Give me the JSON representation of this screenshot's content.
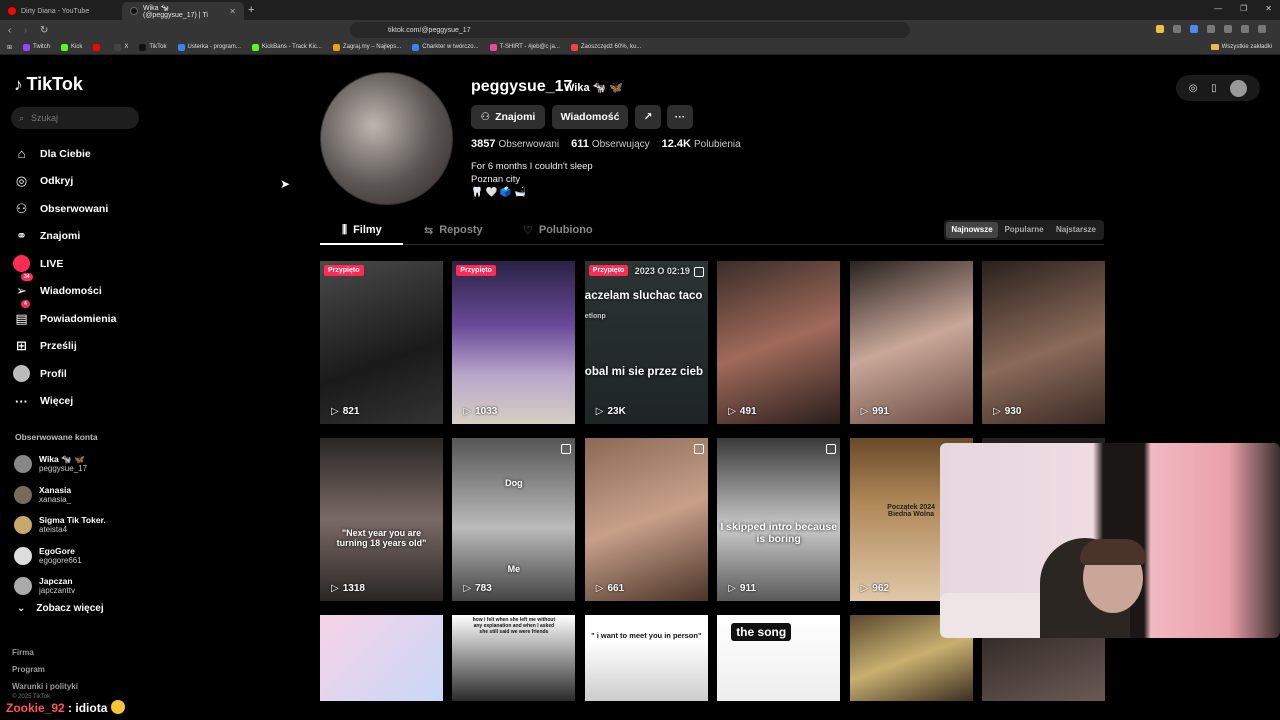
{
  "browser": {
    "tabs": [
      {
        "title": "Dirty Diana - YouTube",
        "active": false,
        "color": "#ff0000"
      },
      {
        "title": "Wika 🐄 (@peggysue_17) | Ti",
        "active": true,
        "color": "#111111"
      }
    ],
    "new_tab": "+",
    "url": "tiktok.com/@peggysue_17",
    "bookmarks": [
      {
        "label": "Twitch",
        "color": "#9146ff"
      },
      {
        "label": "Kick",
        "color": "#53fc18"
      },
      {
        "label": "",
        "color": "#ff0000"
      },
      {
        "label": "X",
        "color": "#444444"
      },
      {
        "label": "TikTok",
        "color": "#111111"
      },
      {
        "label": "Usterka - program...",
        "color": "#3b82f6"
      },
      {
        "label": "KickBans - Track Kic...",
        "color": "#53fc18"
      },
      {
        "label": "Zagraj.my – Najleps...",
        "color": "#f59e0b"
      },
      {
        "label": "Charkter w twórczo...",
        "color": "#3b82f6"
      },
      {
        "label": "T-SHIRT - #jeb@c ja...",
        "color": "#ec4899"
      },
      {
        "label": "Zaoszczędź 60%, ku...",
        "color": "#ef4444"
      }
    ],
    "bookmarks_right": "Wszystkie zakładki"
  },
  "sidebar": {
    "logo": "TikTok",
    "search_placeholder": "Szukaj",
    "nav": [
      {
        "label": "Dla Ciebie",
        "icon": "home-icon",
        "glyph": "⌂"
      },
      {
        "label": "Odkryj",
        "icon": "compass-icon",
        "glyph": "◎"
      },
      {
        "label": "Obserwowani",
        "icon": "following-icon",
        "glyph": "⚇"
      },
      {
        "label": "Znajomi",
        "icon": "friends-icon",
        "glyph": "⚭"
      },
      {
        "label": "LIVE",
        "icon": "live-icon",
        "glyph": ""
      },
      {
        "label": "Wiadomości",
        "icon": "messages-icon",
        "glyph": "➢",
        "badge": "34"
      },
      {
        "label": "Powiadomienia",
        "icon": "notifications-icon",
        "glyph": "▤",
        "badge": "4"
      },
      {
        "label": "Prześlij",
        "icon": "upload-icon",
        "glyph": "⊞"
      },
      {
        "label": "Profil",
        "icon": "profile-icon",
        "glyph": ""
      },
      {
        "label": "Więcej",
        "icon": "more-icon",
        "glyph": "···"
      }
    ],
    "following_title": "Obserwowane konta",
    "following": [
      {
        "name": "Wika 🐄 🦋",
        "user": "peggysue_17",
        "color": "#888888"
      },
      {
        "name": "Xanasia",
        "user": "xanasia_",
        "color": "#7a6a5a"
      },
      {
        "name": "Sigma Tik Toker.",
        "user": "ateista4",
        "color": "#c9a86a"
      },
      {
        "name": "EgoGore",
        "user": "egogore661",
        "color": "#dddddd"
      },
      {
        "name": "Japczan",
        "user": "japczanttv",
        "color": "#aaaaaa"
      }
    ],
    "see_more": "Zobacz więcej",
    "footer": [
      "Firma",
      "Program",
      "Warunki i polityki"
    ],
    "copyright": "© 2025 TikTok"
  },
  "profile": {
    "username": "peggysue_17",
    "nickname": "Wika 🐄 🦋",
    "buttons": {
      "friends": "Znajomi",
      "message": "Wiadomość"
    },
    "stats": [
      {
        "value": "3857",
        "label": "Obserwowani"
      },
      {
        "value": "611",
        "label": "Obserwujący"
      },
      {
        "value": "12.4K",
        "label": "Polubienia"
      }
    ],
    "bio": [
      "For 6 months I couldn't sleep",
      "Poznan city",
      "🦷 🤍 🗳️ 🛁"
    ]
  },
  "tabs": [
    {
      "label": "Filmy",
      "glyph": "⫼"
    },
    {
      "label": "Reposty",
      "glyph": "⇆"
    },
    {
      "label": "Polubiono",
      "glyph": "♡"
    }
  ],
  "sort": [
    "Najnowsze",
    "Popularne",
    "Najstarsze"
  ],
  "videos": [
    {
      "views": "821",
      "pinned": "Przypięto",
      "bg": "linear-gradient(160deg,#4a4a4a,#1a1a1a 60%,#333)"
    },
    {
      "views": "1033",
      "pinned": "Przypięto",
      "bg": "linear-gradient(180deg,#2b2244,#6a4a9a 40%,#b7a6c9 70%,#d8cfc4)"
    },
    {
      "views": "23K",
      "pinned": "Przypięto",
      "bg": "linear-gradient(180deg,#2c3433,#1e2524)",
      "caption_top": "aczelam sluchac taco",
      "caption_mid": "obal mi sie przez cieb",
      "date": "2023 O 02:19",
      "small": "etlonp"
    },
    {
      "views": "491",
      "bg": "linear-gradient(160deg,#3a2c28,#a06a5a 50%,#2a1e1c)"
    },
    {
      "views": "991",
      "bg": "linear-gradient(160deg,#2a2220,#c9a89a 50%,#6a4a40)"
    },
    {
      "views": "930",
      "bg": "linear-gradient(160deg,#2a201c,#8a6a5a 55%,#3a2a24)"
    },
    {
      "views": "1318",
      "bg": "linear-gradient(180deg,#2a2624,#7a6a66 50%,#2a2624)",
      "caption": "\"Next year you are turning 18 years old\""
    },
    {
      "views": "783",
      "bg": "linear-gradient(180deg,#555,#bbb 55%,#444)",
      "label_top": "Dog",
      "label_bottom": "Me"
    },
    {
      "views": "661",
      "bg": "linear-gradient(160deg,#8a6a55,#c8a08a 50%,#4a3428)"
    },
    {
      "views": "911",
      "bg": "linear-gradient(180deg,#3a3a3a,#c9c9c9 55%,#5a5a5a)",
      "caption": "I skipped intro because is boring"
    },
    {
      "views": "962",
      "bg": "linear-gradient(180deg,#6a4a2a,#b08858 40%,#e0c8a8)",
      "caption": "Początek 2024 Biedna Wolna"
    },
    {
      "views": "",
      "bg": "#222222"
    },
    {
      "views": "",
      "bg": "linear-gradient(135deg,#f7d3e6,#c8d8f8)"
    },
    {
      "views": "",
      "bg": "linear-gradient(180deg,#ffffff,#2a2a2a)",
      "caption": "how i felt when she left me without any explanation and when I asked she still said we were friends"
    },
    {
      "views": "",
      "bg": "linear-gradient(180deg,#ffffff 30%,#ccc)",
      "caption": "\" i want to meet you in person\""
    },
    {
      "views": "",
      "bg": "linear-gradient(180deg,#ffffff,#eeeeee)",
      "caption": "the song"
    },
    {
      "views": "",
      "bg": "linear-gradient(160deg,#5a4a30,#c9b070 50%,#3a2e20)"
    },
    {
      "views": "",
      "bg": "linear-gradient(160deg,#2a2220,#6a5a54)"
    }
  ],
  "chat": {
    "user": "Zookie_92",
    "message": "idiota"
  },
  "colors": {
    "accent": "#fe2c55",
    "background": "#000000"
  }
}
